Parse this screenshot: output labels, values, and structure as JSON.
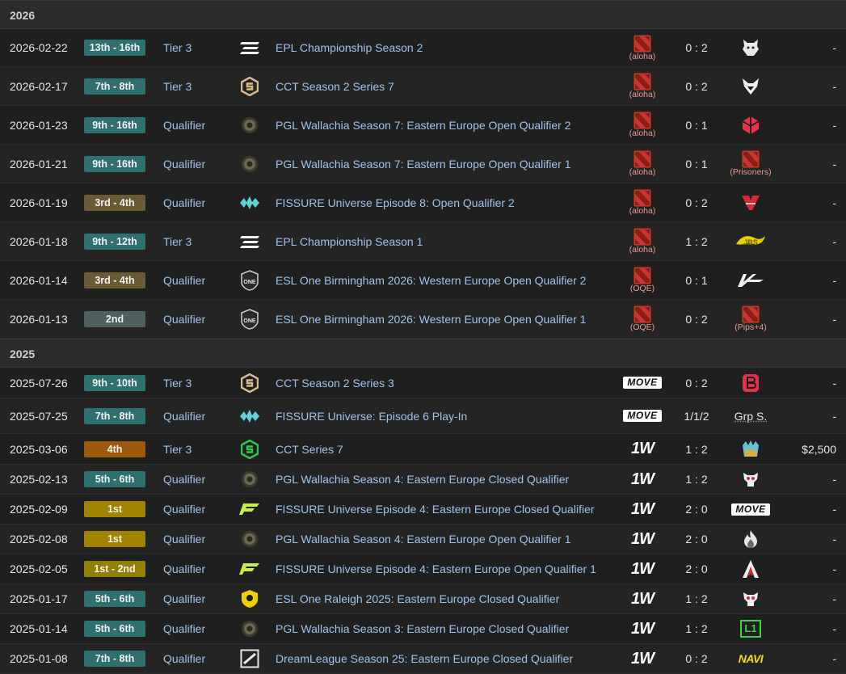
{
  "groups": [
    {
      "year": "2026",
      "rows": [
        {
          "date": "2026-02-22",
          "placement": "13th - 16th",
          "placement_color": "teal",
          "tier": "Tier 3",
          "tlogo": "epl",
          "tournament": "EPL Championship Season 2",
          "team": "dota",
          "team_sub": "(aloha)",
          "score": "0 : 2",
          "opp": "wolf",
          "opp_sub": "",
          "opp_text": "",
          "prize": "-"
        },
        {
          "date": "2026-02-17",
          "placement": "7th - 8th",
          "placement_color": "teal",
          "tier": "Tier 3",
          "tlogo": "cct",
          "tournament": "CCT Season 2 Series 7",
          "team": "dota",
          "team_sub": "(aloha)",
          "score": "0 : 2",
          "opp": "fox",
          "opp_sub": "",
          "opp_text": "",
          "prize": "-"
        },
        {
          "date": "2026-01-23",
          "placement": "9th - 16th",
          "placement_color": "teal",
          "tier": "Qualifier",
          "tlogo": "pgl",
          "tournament": "PGL Wallachia Season 7: Eastern Europe Open Qualifier 2",
          "team": "dota",
          "team_sub": "(aloha)",
          "score": "0 : 1",
          "opp": "redcube",
          "opp_sub": "",
          "opp_text": "",
          "prize": "-"
        },
        {
          "date": "2026-01-21",
          "placement": "9th - 16th",
          "placement_color": "teal",
          "tier": "Qualifier",
          "tlogo": "pgl",
          "tournament": "PGL Wallachia Season 7: Eastern Europe Open Qualifier 1",
          "team": "dota",
          "team_sub": "(aloha)",
          "score": "0 : 1",
          "opp": "dota",
          "opp_sub": "(Prisoners)",
          "opp_text": "",
          "prize": "-"
        },
        {
          "date": "2026-01-19",
          "placement": "3rd - 4th",
          "placement_color": "brown",
          "tier": "Qualifier",
          "tlogo": "fissure",
          "tournament": "FISSURE Universe Episode 8: Open Qualifier 2",
          "team": "dota",
          "team_sub": "(aloha)",
          "score": "0 : 2",
          "opp": "vp",
          "opp_sub": "",
          "opp_text": "",
          "prize": "-"
        },
        {
          "date": "2026-01-18",
          "placement": "9th - 12th",
          "placement_color": "teal",
          "tier": "Tier 3",
          "tlogo": "epl",
          "tournament": "EPL Championship Season 1",
          "team": "dota",
          "team_sub": "(aloha)",
          "score": "1 : 2",
          "opp": "yellow",
          "opp_sub": "",
          "opp_text": "",
          "prize": "-"
        },
        {
          "date": "2026-01-14",
          "placement": "3rd - 4th",
          "placement_color": "brown",
          "tier": "Qualifier",
          "tlogo": "eslone",
          "tournament": "ESL One Birmingham 2026: Western Europe Open Qualifier 2",
          "team": "dota",
          "team_sub": "(OQE)",
          "score": "0 : 1",
          "opp": "arrow",
          "opp_sub": "",
          "opp_text": "",
          "prize": "-"
        },
        {
          "date": "2026-01-13",
          "placement": "2nd",
          "placement_color": "slate",
          "tier": "Qualifier",
          "tlogo": "eslone",
          "tournament": "ESL One Birmingham 2026: Western Europe Open Qualifier 1",
          "team": "dota",
          "team_sub": "(OQE)",
          "score": "0 : 2",
          "opp": "dota",
          "opp_sub": "(Pips+4)",
          "opp_text": "",
          "prize": "-"
        }
      ]
    },
    {
      "year": "2025",
      "rows": [
        {
          "date": "2025-07-26",
          "placement": "9th - 10th",
          "placement_color": "teal",
          "tier": "Tier 3",
          "tlogo": "cct",
          "tournament": "CCT Season 2 Series 3",
          "team": "move",
          "team_sub": "",
          "score": "0 : 2",
          "opp": "bb",
          "opp_sub": "",
          "opp_text": "",
          "prize": "-"
        },
        {
          "date": "2025-07-25",
          "placement": "7th - 8th",
          "placement_color": "teal",
          "tier": "Qualifier",
          "tlogo": "fissure",
          "tournament": "FISSURE Universe: Episode 6 Play-In",
          "team": "move",
          "team_sub": "",
          "score": "1/1/2",
          "opp": "text",
          "opp_sub": "",
          "opp_text": "Grp S.",
          "prize": "-"
        },
        {
          "date": "2025-03-06",
          "placement": "4th",
          "placement_color": "orange",
          "tier": "Tier 3",
          "tlogo": "cctgreen",
          "tournament": "CCT Series 7",
          "team": "onew",
          "team_sub": "",
          "score": "1 : 2",
          "opp": "crown",
          "opp_sub": "",
          "opp_text": "",
          "prize": "$2,500"
        },
        {
          "date": "2025-02-13",
          "placement": "5th - 6th",
          "placement_color": "teal",
          "tier": "Qualifier",
          "tlogo": "pgl",
          "tournament": "PGL Wallachia Season 4: Eastern Europe Closed Qualifier",
          "team": "onew",
          "team_sub": "",
          "score": "1 : 2",
          "opp": "skull",
          "opp_sub": "",
          "opp_text": "",
          "prize": "-"
        },
        {
          "date": "2025-02-09",
          "placement": "1st",
          "placement_color": "gold",
          "tier": "Qualifier",
          "tlogo": "fissureF",
          "tournament": "FISSURE Universe Episode 4: Eastern Europe Closed Qualifier",
          "team": "onew",
          "team_sub": "",
          "score": "2 : 0",
          "opp": "move",
          "opp_sub": "",
          "opp_text": "",
          "prize": "-"
        },
        {
          "date": "2025-02-08",
          "placement": "1st",
          "placement_color": "gold",
          "tier": "Qualifier",
          "tlogo": "pgl",
          "tournament": "PGL Wallachia Season 4: Eastern Europe Open Qualifier 1",
          "team": "onew",
          "team_sub": "",
          "score": "2 : 0",
          "opp": "flame",
          "opp_sub": "",
          "opp_text": "",
          "prize": "-"
        },
        {
          "date": "2025-02-05",
          "placement": "1st - 2nd",
          "placement_color": "gold2",
          "tier": "Qualifier",
          "tlogo": "fissureF",
          "tournament": "FISSURE Universe Episode 4: Eastern Europe Open Qualifier 1",
          "team": "onew",
          "team_sub": "",
          "score": "2 : 0",
          "opp": "aurora",
          "opp_sub": "",
          "opp_text": "",
          "prize": "-"
        },
        {
          "date": "2025-01-17",
          "placement": "5th - 6th",
          "placement_color": "teal",
          "tier": "Qualifier",
          "tlogo": "eslshield",
          "tournament": "ESL One Raleigh 2025: Eastern Europe Closed Qualifier",
          "team": "onew",
          "team_sub": "",
          "score": "1 : 2",
          "opp": "skull",
          "opp_sub": "",
          "opp_text": "",
          "prize": "-"
        },
        {
          "date": "2025-01-14",
          "placement": "5th - 6th",
          "placement_color": "teal",
          "tier": "Qualifier",
          "tlogo": "pgl",
          "tournament": "PGL Wallachia Season 3: Eastern Europe Closed Qualifier",
          "team": "onew",
          "team_sub": "",
          "score": "1 : 2",
          "opp": "l1",
          "opp_sub": "",
          "opp_text": "",
          "prize": "-"
        },
        {
          "date": "2025-01-08",
          "placement": "7th - 8th",
          "placement_color": "teal",
          "tier": "Qualifier",
          "tlogo": "dreamleague",
          "tournament": "DreamLeague Season 25: Eastern Europe Closed Qualifier",
          "team": "onew",
          "team_sub": "",
          "score": "0 : 2",
          "opp": "navi",
          "opp_sub": "",
          "opp_text": "",
          "prize": "-"
        }
      ]
    }
  ],
  "team_logos": {
    "move": "MOVE",
    "onew": "1W",
    "l1": "L1",
    "navi": "NAVI"
  },
  "icons": {
    "epl": "epl-icon",
    "cct": "cct-icon",
    "cctgreen": "cct-green-icon",
    "pgl": "pgl-icon",
    "fissure": "fissure-icon",
    "fissureF": "fissure-f-icon",
    "eslone": "esl-one-icon",
    "eslshield": "esl-shield-icon",
    "dreamleague": "dreamleague-icon",
    "dota": "dota2-icon",
    "wolf": "wolf-icon",
    "fox": "fox-icon",
    "redcube": "red-cube-icon",
    "vp": "virtus-pro-icon",
    "yellow": "yellow-team-icon",
    "arrow": "arrow-team-icon",
    "bb": "bb-team-icon",
    "crown": "crown-team-icon",
    "skull": "skull-team-icon",
    "flame": "flame-team-icon",
    "aurora": "aurora-icon"
  },
  "colors": {
    "teal": "#2e7070",
    "brown": "#6a5a35",
    "slate": "#4f6060",
    "orange": "#9a5a0a",
    "gold": "#a08400",
    "gold2": "#938000",
    "link": "#9fc3ec",
    "dota_red": "#c8382a"
  }
}
